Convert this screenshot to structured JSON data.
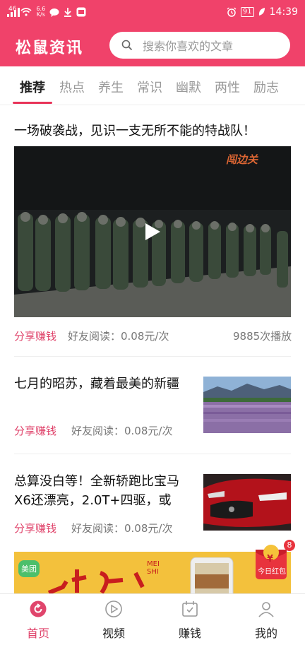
{
  "status_bar": {
    "signal": "46",
    "net_speed_top": "6.6",
    "net_speed_bottom": "K/s",
    "battery": "91",
    "time": "14:39"
  },
  "header": {
    "logo": "松鼠资讯",
    "search_placeholder": "搜索你喜欢的文章"
  },
  "tabs": [
    "推荐",
    "热点",
    "养生",
    "常识",
    "幽默",
    "两性",
    "励志"
  ],
  "feed": {
    "video_post": {
      "title": "一场破袭战，见识一支无所不能的特战队！",
      "share": "分享赚钱",
      "friend_read": "好友阅读：0.08元/次",
      "plays": "9885次播放",
      "watermark": "闯边关"
    },
    "articles": [
      {
        "title": "七月的昭苏，藏着最美的新疆",
        "share": "分享赚钱",
        "friend_read": "好友阅读：0.08元/次"
      },
      {
        "title": "总算没白等！全新轿跑比宝马X6还漂亮，2.0T+四驱，或",
        "share": "分享赚钱",
        "friend_read": "好友阅读：0.08元/次"
      }
    ],
    "ad": {
      "brand": "美团",
      "text_en": "MEI SHI"
    }
  },
  "red_packet": {
    "label": "今日红包",
    "badge": "8",
    "symbol": "¥"
  },
  "bottom_nav": [
    {
      "label": "首页",
      "icon": "home-icon",
      "active": true
    },
    {
      "label": "视频",
      "icon": "play-circle-icon",
      "active": false
    },
    {
      "label": "赚钱",
      "icon": "calendar-check-icon",
      "active": false
    },
    {
      "label": "我的",
      "icon": "person-icon",
      "active": false
    }
  ],
  "colors": {
    "brand": "#f0426a",
    "accent": "#e0456c",
    "tab_underline": "#e83358"
  }
}
